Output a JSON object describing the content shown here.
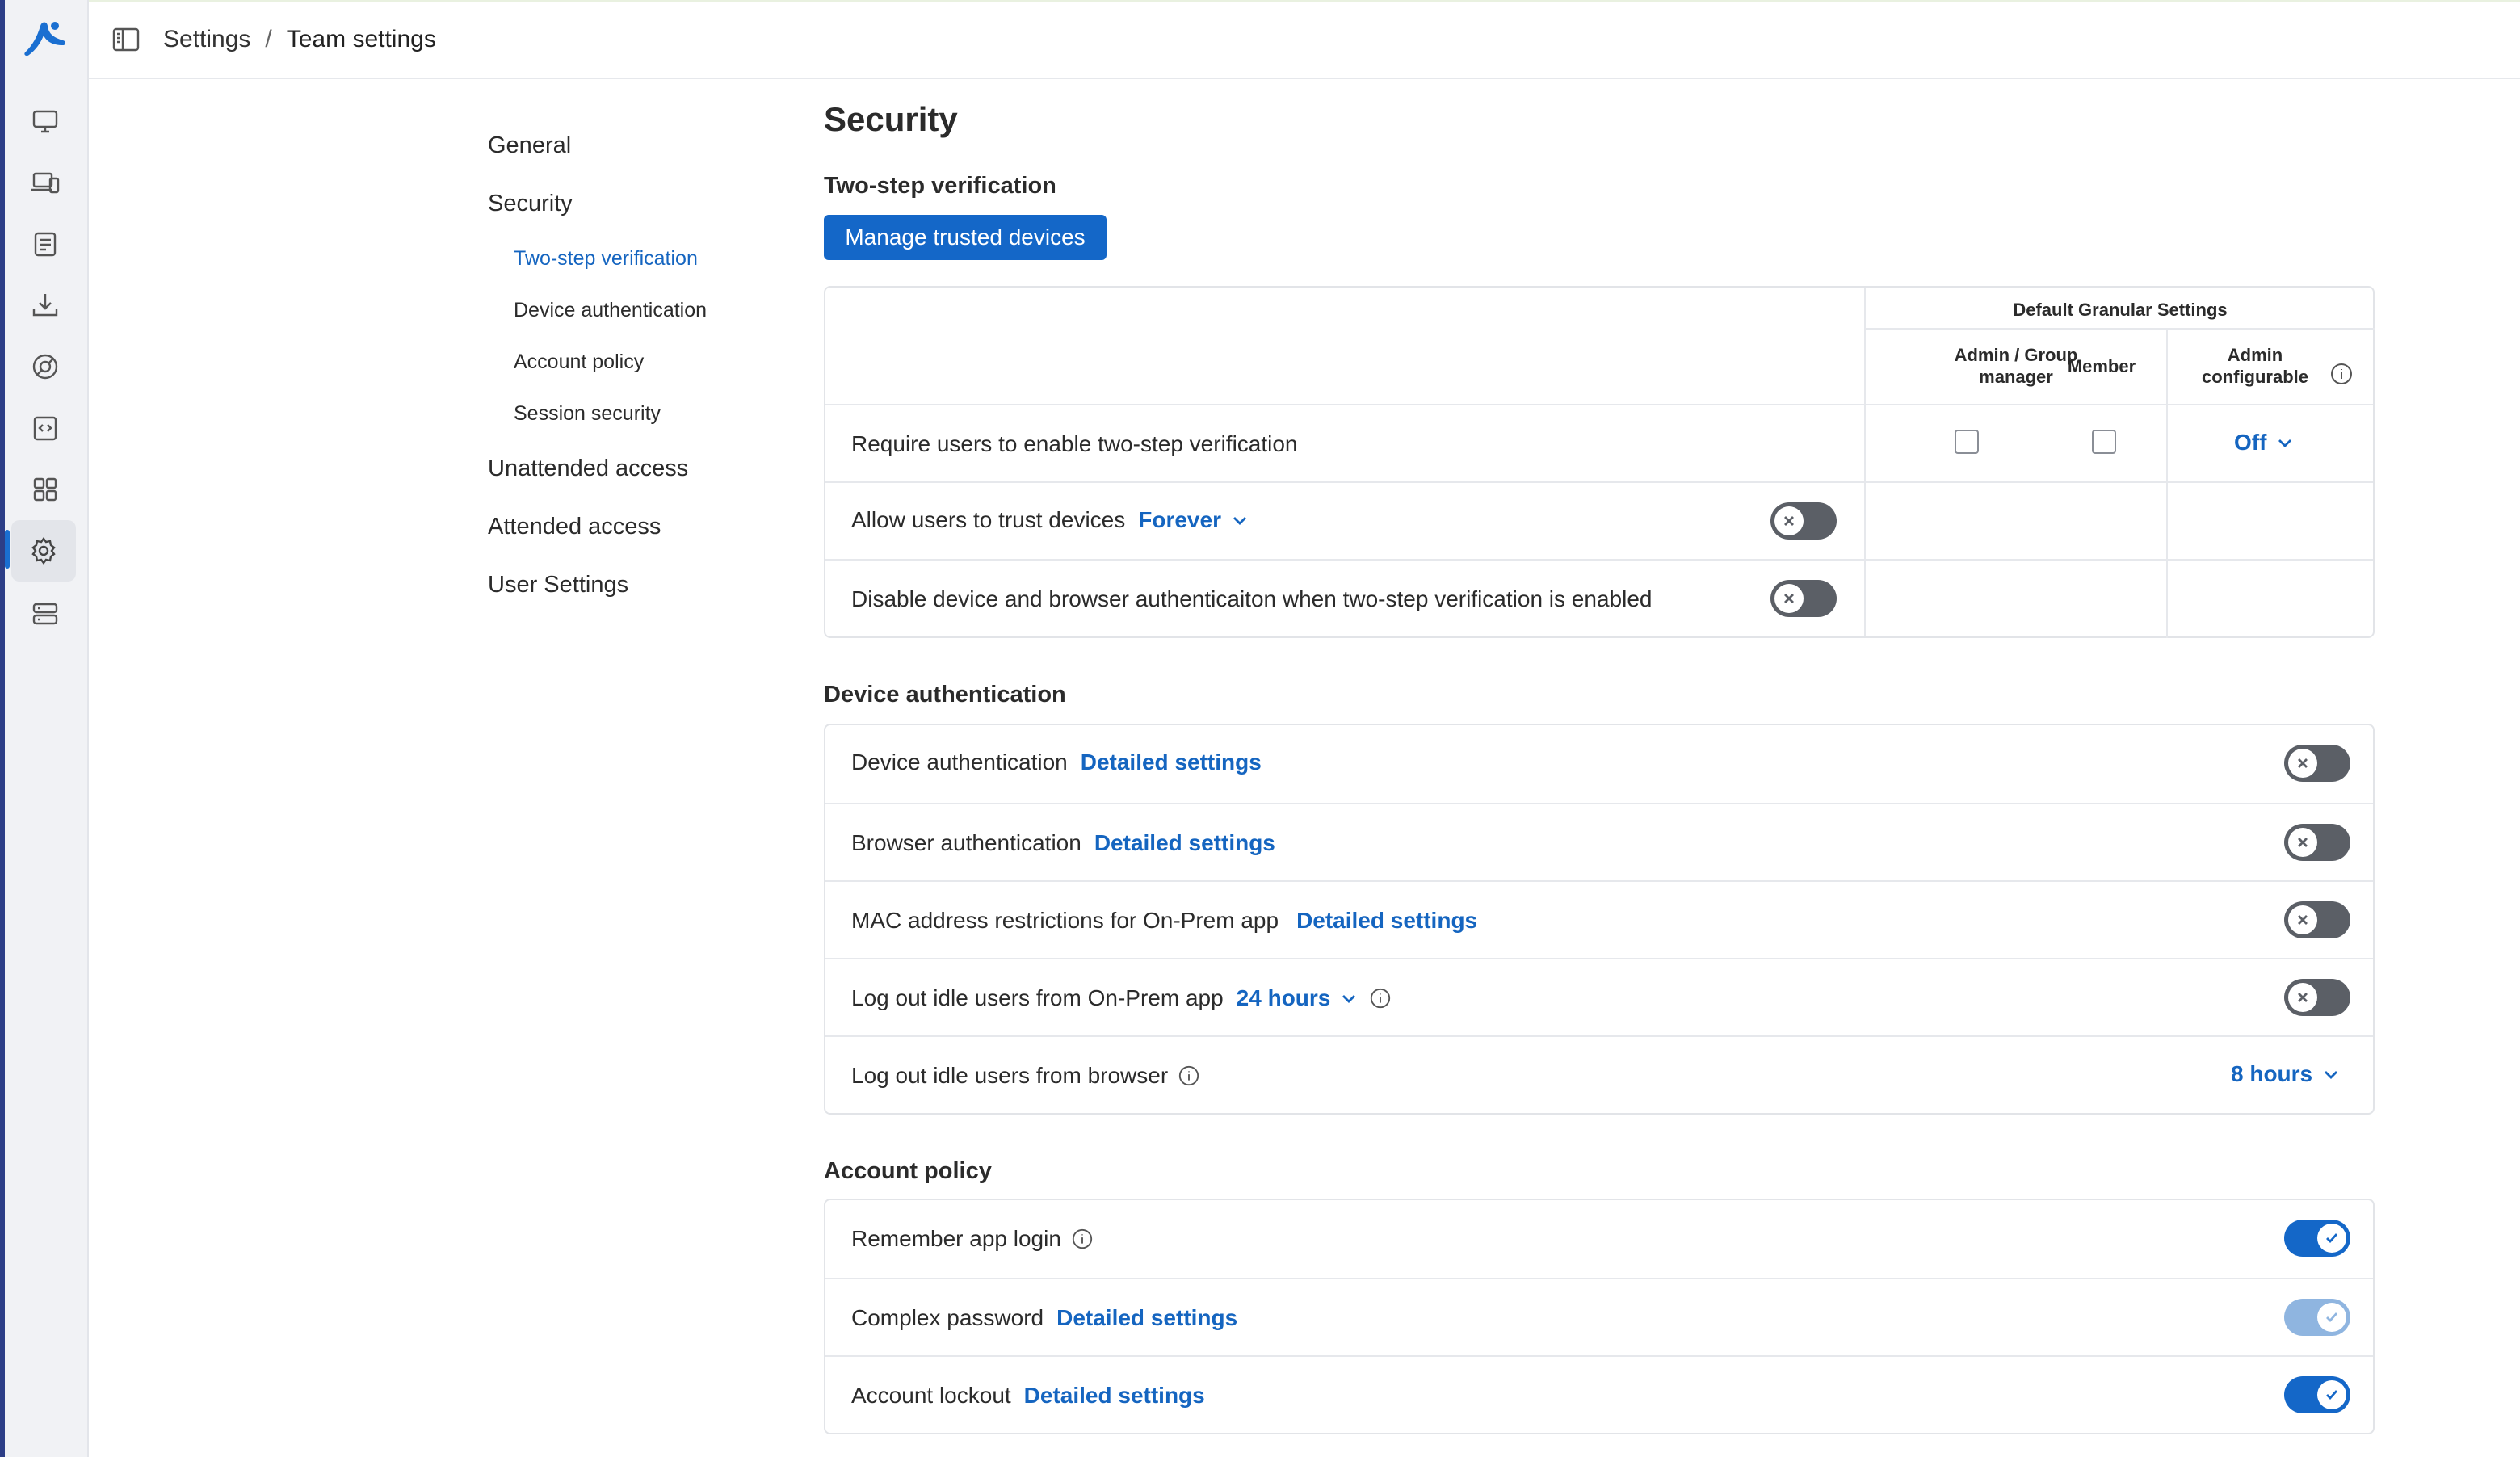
{
  "breadcrumb": {
    "root": "Settings",
    "separator": "/",
    "current": "Team settings"
  },
  "settings_nav": {
    "general": "General",
    "security": "Security",
    "security_sub": [
      "Two-step verification",
      "Device authentication",
      "Account policy",
      "Session security"
    ],
    "unattended": "Unattended access",
    "attended": "Attended access",
    "user_settings": "User Settings"
  },
  "page_title": "Security",
  "two_step": {
    "heading": "Two-step verification",
    "manage_button": "Manage trusted devices",
    "granular_header": "Default Granular Settings",
    "col_admin": "Admin / Group manager",
    "col_admin_line1": "Admin / Group",
    "col_admin_line2": "manager",
    "col_member": "Member",
    "col_config_line1": "Admin",
    "col_config_line2": "configurable",
    "rows": {
      "require": {
        "label": "Require users to enable two-step verification",
        "config_value": "Off"
      },
      "trust": {
        "label": "Allow users to trust devices",
        "value": "Forever"
      },
      "disable": {
        "label": "Disable device and browser authenticaiton when two-step verification is enabled"
      }
    }
  },
  "device_auth": {
    "heading": "Device authentication",
    "rows": [
      {
        "label": "Device authentication",
        "link": "Detailed settings"
      },
      {
        "label": "Browser authentication",
        "link": "Detailed settings"
      },
      {
        "label": "MAC address restrictions for On-Prem app",
        "link": "Detailed settings"
      },
      {
        "label": "Log out idle users from On-Prem app",
        "value": "24 hours"
      },
      {
        "label": "Log out idle users from browser",
        "value": "8 hours"
      }
    ]
  },
  "account_policy": {
    "heading": "Account policy",
    "rows": [
      {
        "label": "Remember app login"
      },
      {
        "label": "Complex password",
        "link": "Detailed settings"
      },
      {
        "label": "Account lockout",
        "link": "Detailed settings"
      }
    ]
  },
  "colors": {
    "accent": "#1467c8",
    "link": "#1565c0",
    "toggle_off": "#5b5f66",
    "rail_bg": "#f1f2f5"
  }
}
